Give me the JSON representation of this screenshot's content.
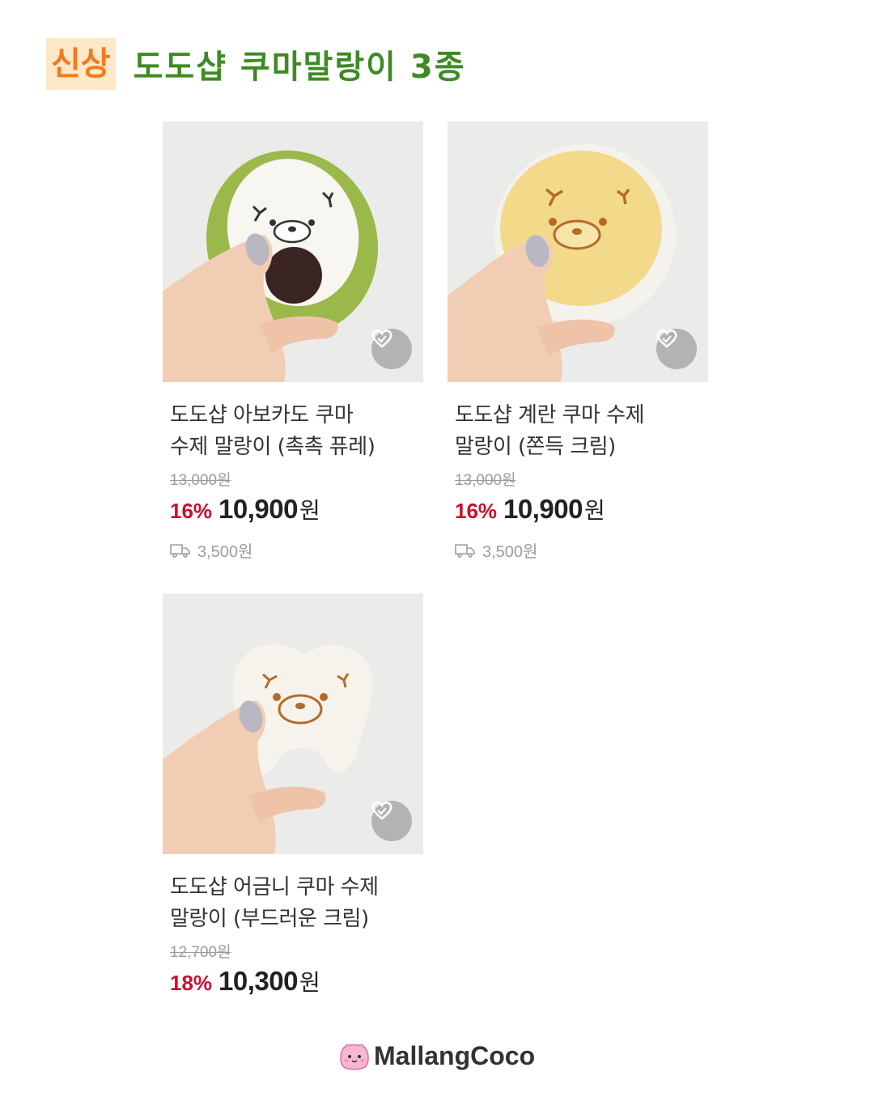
{
  "header": {
    "badge": "신상",
    "title": "도도샵 쿠마말랑이 3종"
  },
  "products": [
    {
      "name_line1": "도도샵 아보카도 쿠마",
      "name_line2": "수제 말랑이 (촉촉 퓨레)",
      "original_price": "13,000원",
      "discount": "16%",
      "price": "10,900",
      "currency": "원",
      "shipping": "3,500원"
    },
    {
      "name_line1": "도도샵 계란 쿠마 수제",
      "name_line2": "말랑이 (쫀득 크림)",
      "original_price": "13,000원",
      "discount": "16%",
      "price": "10,900",
      "currency": "원",
      "shipping": "3,500원"
    },
    {
      "name_line1": "도도샵 어금니 쿠마 수제",
      "name_line2": "말랑이 (부드러운 크림)",
      "original_price": "12,700원",
      "discount": "18%",
      "price": "10,300",
      "currency": "원"
    }
  ],
  "footer": {
    "brand": "MallangCoco"
  },
  "colors": {
    "title": "#3e8a24",
    "badge_text": "#f07a1e",
    "badge_bg": "#fde8c8",
    "discount": "#c8102e"
  }
}
